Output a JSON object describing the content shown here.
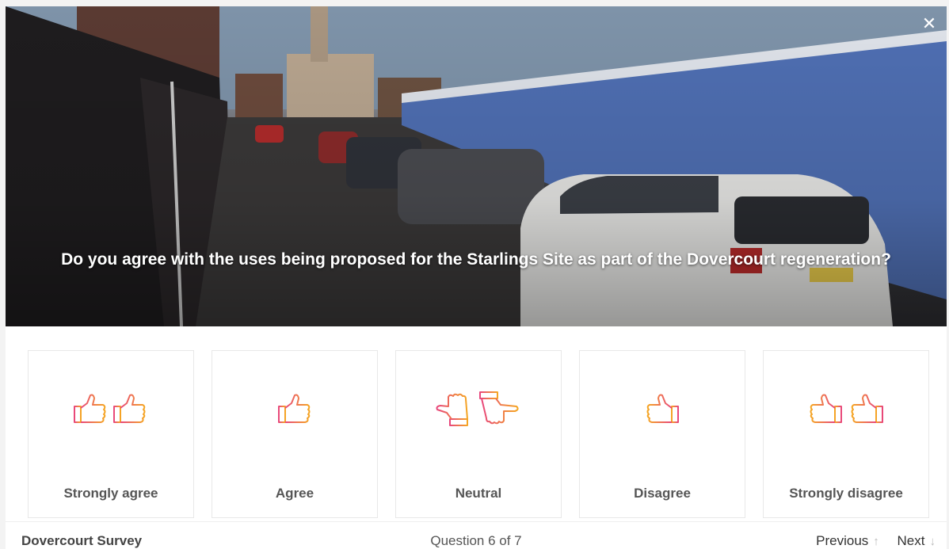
{
  "close": {
    "symbol": "✕"
  },
  "question": {
    "text": "Do you agree with the uses being proposed for the Starlings Site as part of the Dovercourt regeneration?"
  },
  "options": [
    {
      "label": "Strongly agree",
      "icon": "double-thumbs-up-icon"
    },
    {
      "label": "Agree",
      "icon": "thumbs-up-icon"
    },
    {
      "label": "Neutral",
      "icon": "neutral-hands-icon"
    },
    {
      "label": "Disagree",
      "icon": "thumbs-down-icon"
    },
    {
      "label": "Strongly disagree",
      "icon": "double-thumbs-down-icon"
    }
  ],
  "footer": {
    "survey_name": "Dovercourt Survey",
    "progress": "Question 6 of 7",
    "previous_label": "Previous",
    "previous_arrow": "↑",
    "next_label": "Next",
    "next_arrow": "↓"
  },
  "colors": {
    "icon_gradient_start": "#e8467c",
    "icon_gradient_end": "#f5a623"
  }
}
